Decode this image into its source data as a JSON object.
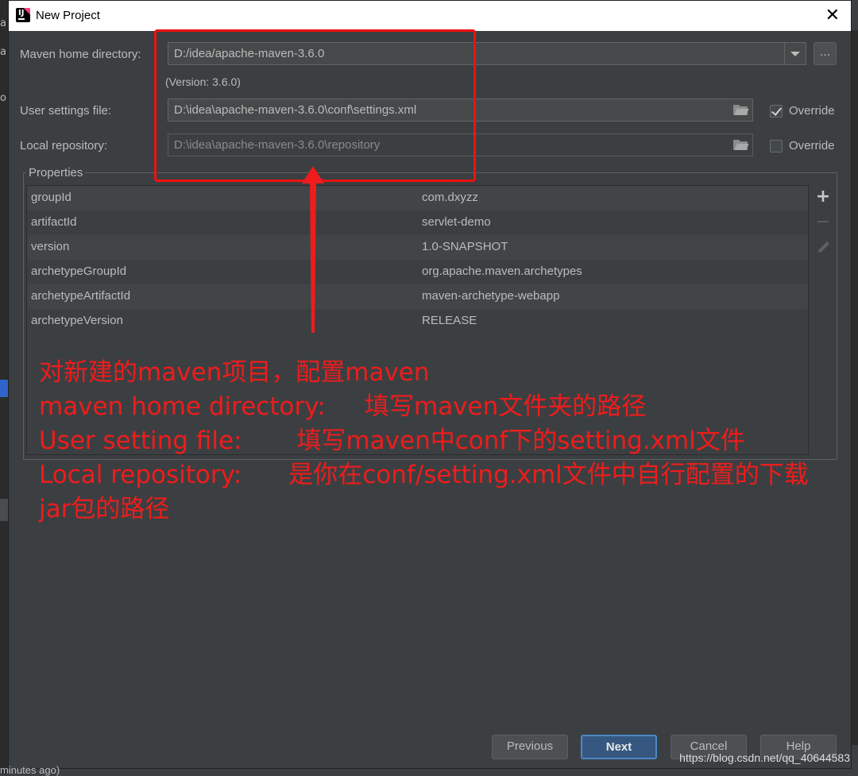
{
  "window": {
    "title": "New Project",
    "close_glyph": "✕"
  },
  "maven": {
    "home_label": "Maven home directory:",
    "home_value": "D:/idea/apache-maven-3.6.0",
    "browse_label": "...",
    "version_text": "(Version: 3.6.0)",
    "user_settings_label": "User settings file:",
    "user_settings_value": "D:\\idea\\apache-maven-3.6.0\\conf\\settings.xml",
    "user_settings_override": "Override",
    "user_settings_override_checked": true,
    "local_repo_label": "Local repository:",
    "local_repo_value": "D:\\idea\\apache-maven-3.6.0\\repository",
    "local_repo_override": "Override",
    "local_repo_override_checked": false
  },
  "properties": {
    "title": "Properties",
    "rows": [
      {
        "key": "groupId",
        "value": "com.dxyzz"
      },
      {
        "key": "artifactId",
        "value": "servlet-demo"
      },
      {
        "key": "version",
        "value": "1.0-SNAPSHOT"
      },
      {
        "key": "archetypeGroupId",
        "value": "org.apache.maven.archetypes"
      },
      {
        "key": "archetypeArtifactId",
        "value": "maven-archetype-webapp"
      },
      {
        "key": "archetypeVersion",
        "value": "RELEASE"
      }
    ],
    "tools": {
      "add": "+",
      "remove": "−"
    }
  },
  "annotation": {
    "line1": "对新建的maven项目，配置maven",
    "line2": "maven home directory:     填写maven文件夹的路径",
    "line3": "User setting file:       填写maven中conf下的setting.xml文件",
    "line4": "Local repository:      是你在conf/setting.xml文件中自行配置的下载",
    "line5": "jar包的路径",
    "color": "#ee1c1c"
  },
  "buttons": {
    "previous": "Previous",
    "next": "Next",
    "cancel": "Cancel",
    "help": "Help"
  },
  "background": {
    "left_chars": [
      "a",
      "a",
      "o"
    ],
    "status": "minutes ago)"
  },
  "watermark": "https://blog.csdn.net/qq_40644583"
}
